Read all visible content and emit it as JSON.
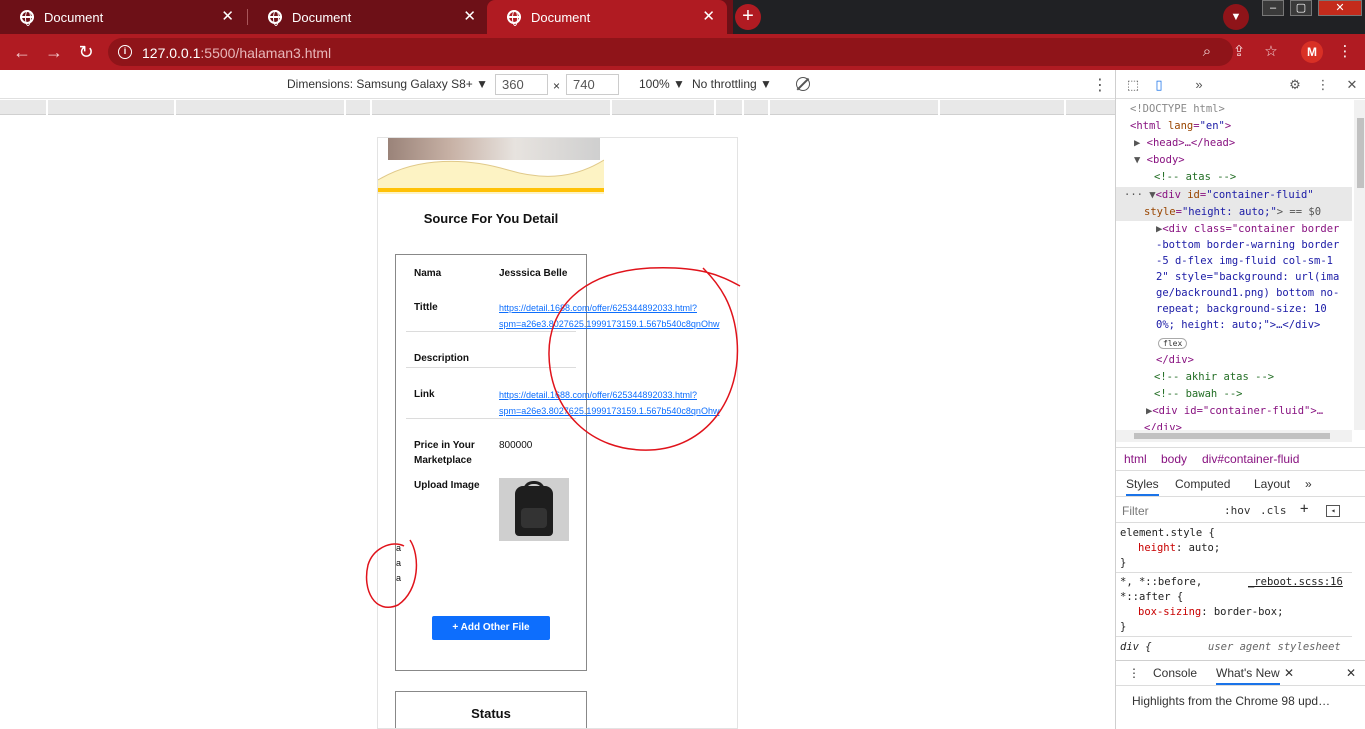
{
  "browser": {
    "tabs": [
      {
        "title": "Document",
        "active": false
      },
      {
        "title": "Document",
        "active": false
      },
      {
        "title": "Document",
        "active": true
      }
    ],
    "new_tab_symbol": "+",
    "url_host": "127.0.0.1",
    "url_path": ":5500/halaman3.html",
    "profile_initial": "M",
    "accent_color": "#b01b22"
  },
  "device_toolbar": {
    "dimensions_label": "Dimensions: Samsung Galaxy S8+ ▼",
    "width": "360",
    "times": "×",
    "height": "740",
    "zoom": "100% ▼",
    "throttling": "No throttling ▼"
  },
  "page": {
    "title": "Source For You Detail",
    "rows": {
      "nama_label": "Nama",
      "nama_value": "Jesssica Belle",
      "tittle_label": "Tittle",
      "tittle_link_1": "https://detail.1688.com/offer/625344892033.html?",
      "tittle_link_2": "spm=a26e3.8027625.1999173159.1.567b540c8qnOhw",
      "description_label": "Description",
      "link_label": "Link",
      "link_1": "https://detail.1688.com/offer/625344892033.html?",
      "link_2": "spm=a26e3.8027625.1999173159.1.567b540c8qnOhw",
      "price_label_1": "Price in Your",
      "price_label_2": "Marketplace",
      "price_value": "800000",
      "upload_label": "Upload Image"
    },
    "stacked_a": [
      "a",
      "a",
      "a"
    ],
    "add_button": "+ Add Other File",
    "status_title": "Status"
  },
  "devtools": {
    "elements": {
      "doctype": "<!DOCTYPE html>",
      "html_open": "<html ",
      "html_attr": "lang",
      "html_val": "\"en\"",
      "head": "<head>…</head>",
      "body_open": "<body>",
      "comment_atas": "<!-- atas -->",
      "div_open": "<div ",
      "div_attr": "id",
      "div_val": "\"container-fluid\"",
      "div_style_attr": "style",
      "div_style_val": "\"height: auto;\"",
      "div_close_marker": "> == $0",
      "inner_1": "<div class=\"container border",
      "inner_2": "-bottom border-warning border",
      "inner_3": "-5 d-flex img-fluid col-sm-1",
      "inner_4": "2\" style=\"background: url(ima",
      "inner_5": "ge/backround1.png) bottom no-",
      "inner_6": "repeat; background-size: 10",
      "inner_7": "0%; height: auto;\">…</div>",
      "flex_badge": "flex",
      "div_end": "</div>",
      "comment_akhir": "<!-- akhir atas -->",
      "comment_bawah": "<!-- bawah -->",
      "div2": "<div id=\"container-fluid\">…",
      "div2_end": "</div>"
    },
    "breadcrumbs": [
      "html",
      "body",
      "div#container-fluid"
    ],
    "sub_tabs": [
      "Styles",
      "Computed",
      "Layout"
    ],
    "filter_placeholder": "Filter",
    "filter_hov": ":hov",
    "filter_cls": ".cls",
    "styles": {
      "rule1_selector": "element.style {",
      "rule1_prop": "height",
      "rule1_val": ": auto;",
      "close": "}",
      "rule2_selector": "*, *::before,",
      "rule2_source": "_reboot.scss:16",
      "rule2_selector2": "*::after {",
      "rule2_prop": "box-sizing",
      "rule2_val": ": border-box;",
      "rule3_selector": "div {",
      "rule3_source": "user agent stylesheet"
    },
    "drawer_tabs": [
      "Console",
      "What's New"
    ],
    "drawer_message": "Highlights from the Chrome 98 upd…"
  }
}
